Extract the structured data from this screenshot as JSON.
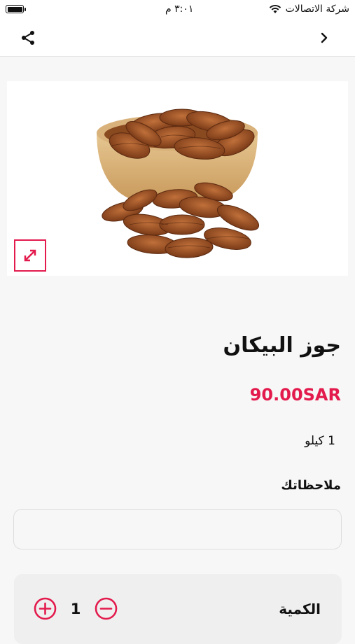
{
  "status_bar": {
    "carrier": "شركة الاتصالات",
    "time": "٣:٠١ م"
  },
  "nav": {
    "share_icon": "share-icon",
    "back_icon": "chevron-right-icon"
  },
  "product": {
    "image_icon": "product-image",
    "expand_icon": "expand-icon",
    "name": "جوز البيكان",
    "price": "90.00SAR",
    "unit": "1 كيلو"
  },
  "notes": {
    "label": "ملاحظاتك",
    "value": "",
    "placeholder": ""
  },
  "quantity": {
    "label": "الكمية",
    "value": "1"
  },
  "colors": {
    "accent": "#e31b4d",
    "background": "#f7f7f7"
  }
}
